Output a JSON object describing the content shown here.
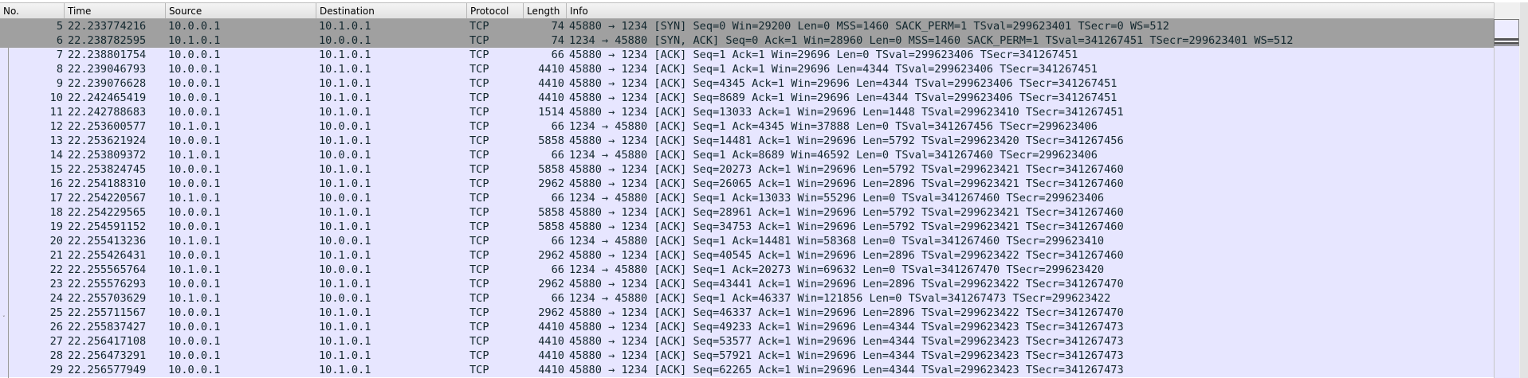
{
  "columns": {
    "no": "No.",
    "time": "Time",
    "source": "Source",
    "destination": "Destination",
    "protocol": "Protocol",
    "length": "Length",
    "info": "Info"
  },
  "colors": {
    "row_bg": "#e7e6ff",
    "syn_row_bg": "#a0a0a0",
    "text": "#12272e"
  },
  "packets": [
    {
      "no": "5",
      "time": "22.233774216",
      "src": "10.0.0.1",
      "dst": "10.1.0.1",
      "proto": "TCP",
      "len": "74",
      "info": "45880 → 1234 [SYN] Seq=0 Win=29200 Len=0 MSS=1460 SACK_PERM=1 TSval=299623401 TSecr=0 WS=512"
    },
    {
      "no": "6",
      "time": "22.238782595",
      "src": "10.1.0.1",
      "dst": "10.0.0.1",
      "proto": "TCP",
      "len": "74",
      "info": "1234 → 45880 [SYN, ACK] Seq=0 Ack=1 Win=28960 Len=0 MSS=1460 SACK_PERM=1 TSval=341267451 TSecr=299623401 WS=512"
    },
    {
      "no": "7",
      "time": "22.238801754",
      "src": "10.0.0.1",
      "dst": "10.1.0.1",
      "proto": "TCP",
      "len": "66",
      "info": "45880 → 1234 [ACK] Seq=1 Ack=1 Win=29696 Len=0 TSval=299623406 TSecr=341267451"
    },
    {
      "no": "8",
      "time": "22.239046793",
      "src": "10.0.0.1",
      "dst": "10.1.0.1",
      "proto": "TCP",
      "len": "4410",
      "info": "45880 → 1234 [ACK] Seq=1 Ack=1 Win=29696 Len=4344 TSval=299623406 TSecr=341267451"
    },
    {
      "no": "9",
      "time": "22.239076628",
      "src": "10.0.0.1",
      "dst": "10.1.0.1",
      "proto": "TCP",
      "len": "4410",
      "info": "45880 → 1234 [ACK] Seq=4345 Ack=1 Win=29696 Len=4344 TSval=299623406 TSecr=341267451"
    },
    {
      "no": "10",
      "time": "22.242465419",
      "src": "10.0.0.1",
      "dst": "10.1.0.1",
      "proto": "TCP",
      "len": "4410",
      "info": "45880 → 1234 [ACK] Seq=8689 Ack=1 Win=29696 Len=4344 TSval=299623406 TSecr=341267451"
    },
    {
      "no": "11",
      "time": "22.242788683",
      "src": "10.0.0.1",
      "dst": "10.1.0.1",
      "proto": "TCP",
      "len": "1514",
      "info": "45880 → 1234 [ACK] Seq=13033 Ack=1 Win=29696 Len=1448 TSval=299623410 TSecr=341267451"
    },
    {
      "no": "12",
      "time": "22.253600577",
      "src": "10.1.0.1",
      "dst": "10.0.0.1",
      "proto": "TCP",
      "len": "66",
      "info": "1234 → 45880 [ACK] Seq=1 Ack=4345 Win=37888 Len=0 TSval=341267456 TSecr=299623406"
    },
    {
      "no": "13",
      "time": "22.253621924",
      "src": "10.0.0.1",
      "dst": "10.1.0.1",
      "proto": "TCP",
      "len": "5858",
      "info": "45880 → 1234 [ACK] Seq=14481 Ack=1 Win=29696 Len=5792 TSval=299623420 TSecr=341267456"
    },
    {
      "no": "14",
      "time": "22.253809372",
      "src": "10.1.0.1",
      "dst": "10.0.0.1",
      "proto": "TCP",
      "len": "66",
      "info": "1234 → 45880 [ACK] Seq=1 Ack=8689 Win=46592 Len=0 TSval=341267460 TSecr=299623406"
    },
    {
      "no": "15",
      "time": "22.253824745",
      "src": "10.0.0.1",
      "dst": "10.1.0.1",
      "proto": "TCP",
      "len": "5858",
      "info": "45880 → 1234 [ACK] Seq=20273 Ack=1 Win=29696 Len=5792 TSval=299623421 TSecr=341267460"
    },
    {
      "no": "16",
      "time": "22.254188310",
      "src": "10.0.0.1",
      "dst": "10.1.0.1",
      "proto": "TCP",
      "len": "2962",
      "info": "45880 → 1234 [ACK] Seq=26065 Ack=1 Win=29696 Len=2896 TSval=299623421 TSecr=341267460"
    },
    {
      "no": "17",
      "time": "22.254220567",
      "src": "10.1.0.1",
      "dst": "10.0.0.1",
      "proto": "TCP",
      "len": "66",
      "info": "1234 → 45880 [ACK] Seq=1 Ack=13033 Win=55296 Len=0 TSval=341267460 TSecr=299623406"
    },
    {
      "no": "18",
      "time": "22.254229565",
      "src": "10.0.0.1",
      "dst": "10.1.0.1",
      "proto": "TCP",
      "len": "5858",
      "info": "45880 → 1234 [ACK] Seq=28961 Ack=1 Win=29696 Len=5792 TSval=299623421 TSecr=341267460"
    },
    {
      "no": "19",
      "time": "22.254591152",
      "src": "10.0.0.1",
      "dst": "10.1.0.1",
      "proto": "TCP",
      "len": "5858",
      "info": "45880 → 1234 [ACK] Seq=34753 Ack=1 Win=29696 Len=5792 TSval=299623421 TSecr=341267460"
    },
    {
      "no": "20",
      "time": "22.255413236",
      "src": "10.1.0.1",
      "dst": "10.0.0.1",
      "proto": "TCP",
      "len": "66",
      "info": "1234 → 45880 [ACK] Seq=1 Ack=14481 Win=58368 Len=0 TSval=341267460 TSecr=299623410"
    },
    {
      "no": "21",
      "time": "22.255426431",
      "src": "10.0.0.1",
      "dst": "10.1.0.1",
      "proto": "TCP",
      "len": "2962",
      "info": "45880 → 1234 [ACK] Seq=40545 Ack=1 Win=29696 Len=2896 TSval=299623422 TSecr=341267460"
    },
    {
      "no": "22",
      "time": "22.255565764",
      "src": "10.1.0.1",
      "dst": "10.0.0.1",
      "proto": "TCP",
      "len": "66",
      "info": "1234 → 45880 [ACK] Seq=1 Ack=20273 Win=69632 Len=0 TSval=341267470 TSecr=299623420"
    },
    {
      "no": "23",
      "time": "22.255576293",
      "src": "10.0.0.1",
      "dst": "10.1.0.1",
      "proto": "TCP",
      "len": "2962",
      "info": "45880 → 1234 [ACK] Seq=43441 Ack=1 Win=29696 Len=2896 TSval=299623422 TSecr=341267470"
    },
    {
      "no": "24",
      "time": "22.255703629",
      "src": "10.1.0.1",
      "dst": "10.0.0.1",
      "proto": "TCP",
      "len": "66",
      "info": "1234 → 45880 [ACK] Seq=1 Ack=46337 Win=121856 Len=0 TSval=341267473 TSecr=299623422"
    },
    {
      "no": "25",
      "time": "22.255711567",
      "src": "10.0.0.1",
      "dst": "10.1.0.1",
      "proto": "TCP",
      "len": "2962",
      "info": "45880 → 1234 [ACK] Seq=46337 Ack=1 Win=29696 Len=2896 TSval=299623422 TSecr=341267470"
    },
    {
      "no": "26",
      "time": "22.255837427",
      "src": "10.0.0.1",
      "dst": "10.1.0.1",
      "proto": "TCP",
      "len": "4410",
      "info": "45880 → 1234 [ACK] Seq=49233 Ack=1 Win=29696 Len=4344 TSval=299623423 TSecr=341267473"
    },
    {
      "no": "27",
      "time": "22.256417108",
      "src": "10.0.0.1",
      "dst": "10.1.0.1",
      "proto": "TCP",
      "len": "4410",
      "info": "45880 → 1234 [ACK] Seq=53577 Ack=1 Win=29696 Len=4344 TSval=299623423 TSecr=341267473"
    },
    {
      "no": "28",
      "time": "22.256473291",
      "src": "10.0.0.1",
      "dst": "10.1.0.1",
      "proto": "TCP",
      "len": "4410",
      "info": "45880 → 1234 [ACK] Seq=57921 Ack=1 Win=29696 Len=4344 TSval=299623423 TSecr=341267473"
    },
    {
      "no": "29",
      "time": "22.256577949",
      "src": "10.0.0.1",
      "dst": "10.1.0.1",
      "proto": "TCP",
      "len": "4410",
      "info": "45880 → 1234 [ACK] Seq=62265 Ack=1 Win=29696 Len=4344 TSval=299623423 TSecr=341267473"
    }
  ]
}
